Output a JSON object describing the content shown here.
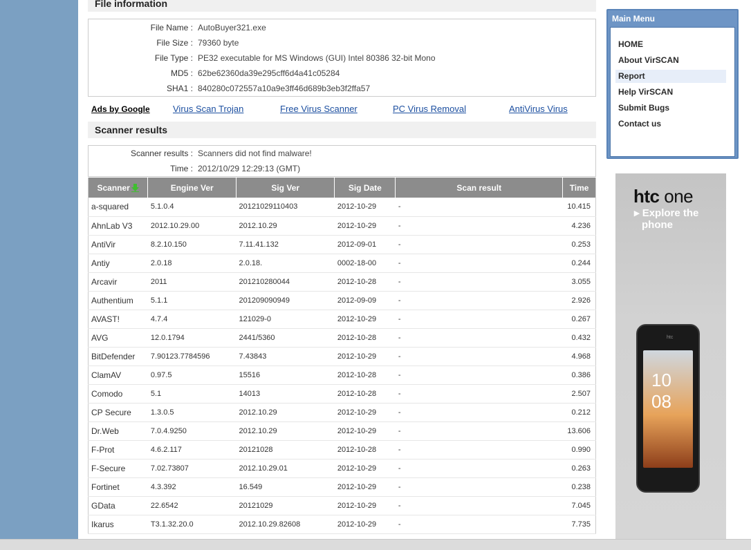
{
  "file_info": {
    "title": "File information",
    "rows": [
      {
        "key": "File Name :",
        "value": "AutoBuyer321.exe"
      },
      {
        "key": "File Size :",
        "value": "79360 byte"
      },
      {
        "key": "File Type :",
        "value": "PE32 executable for MS Windows (GUI) Intel 80386 32-bit Mono"
      },
      {
        "key": "MD5 :",
        "value": "62be62360da39e295cff6d4a41c05284"
      },
      {
        "key": "SHA1 :",
        "value": "840280c072557a10a9e3ff46d689b3eb3f2ffa57"
      }
    ]
  },
  "ads": {
    "label": "Ads by Google",
    "links": [
      "Virus Scan Trojan",
      "Free Virus Scanner",
      "PC Virus Removal",
      "AntiVirus Virus"
    ]
  },
  "scanner_results": {
    "title": "Scanner results",
    "summary": [
      {
        "key": "Scanner results :",
        "value": "Scanners did not find malware!"
      },
      {
        "key": "Time :",
        "value": "2012/10/29 12:29:13 (GMT)"
      }
    ],
    "columns": [
      "Scanner",
      "Engine Ver",
      "Sig Ver",
      "Sig Date",
      "Scan result",
      "Time"
    ],
    "rows": [
      [
        "a-squared",
        "5.1.0.4",
        "20121029110403",
        "2012-10-29",
        "-",
        "10.415"
      ],
      [
        "AhnLab V3",
        "2012.10.29.00",
        "2012.10.29",
        "2012-10-29",
        "-",
        "4.236"
      ],
      [
        "AntiVir",
        "8.2.10.150",
        "7.11.41.132",
        "2012-09-01",
        "-",
        "0.253"
      ],
      [
        "Antiy",
        "2.0.18",
        "2.0.18.",
        "0002-18-00",
        "-",
        "0.244"
      ],
      [
        "Arcavir",
        "2011",
        "201210280044",
        "2012-10-28",
        "-",
        "3.055"
      ],
      [
        "Authentium",
        "5.1.1",
        "201209090949",
        "2012-09-09",
        "-",
        "2.926"
      ],
      [
        "AVAST!",
        "4.7.4",
        "121029-0",
        "2012-10-29",
        "-",
        "0.267"
      ],
      [
        "AVG",
        "12.0.1794",
        "2441/5360",
        "2012-10-28",
        "-",
        "0.432"
      ],
      [
        "BitDefender",
        "7.90123.7784596",
        "7.43843",
        "2012-10-29",
        "-",
        "4.968"
      ],
      [
        "ClamAV",
        "0.97.5",
        "15516",
        "2012-10-28",
        "-",
        "0.386"
      ],
      [
        "Comodo",
        "5.1",
        "14013",
        "2012-10-28",
        "-",
        "2.507"
      ],
      [
        "CP Secure",
        "1.3.0.5",
        "2012.10.29",
        "2012-10-29",
        "-",
        "0.212"
      ],
      [
        "Dr.Web",
        "7.0.4.9250",
        "2012.10.29",
        "2012-10-29",
        "-",
        "13.606"
      ],
      [
        "F-Prot",
        "4.6.2.117",
        "20121028",
        "2012-10-28",
        "-",
        "0.990"
      ],
      [
        "F-Secure",
        "7.02.73807",
        "2012.10.29.01",
        "2012-10-29",
        "-",
        "0.263"
      ],
      [
        "Fortinet",
        "4.3.392",
        "16.549",
        "2012-10-29",
        "-",
        "0.238"
      ],
      [
        "GData",
        "22.6542",
        "20121029",
        "2012-10-29",
        "-",
        "7.045"
      ],
      [
        "Ikarus",
        "T3.1.32.20.0",
        "2012.10.29.82608",
        "2012-10-29",
        "-",
        "7.735"
      ]
    ]
  },
  "main_menu": {
    "title": "Main Menu",
    "items": [
      "HOME",
      "About VirSCAN",
      "Report",
      "Help VirSCAN",
      "Submit Bugs",
      "Contact us"
    ],
    "active": "Report"
  },
  "ad_banner": {
    "logo_brand": "htc",
    "logo_model": "one",
    "tagline_line1": "▸ Explore the",
    "tagline_line2": "phone",
    "phone_clock": "10 08",
    "phone_brand": "htc"
  },
  "colors": {
    "background": "#7ba0c2",
    "table_header": "#8c8c8c",
    "link": "#1c4fa0",
    "menu_border": "#5a84b8"
  }
}
